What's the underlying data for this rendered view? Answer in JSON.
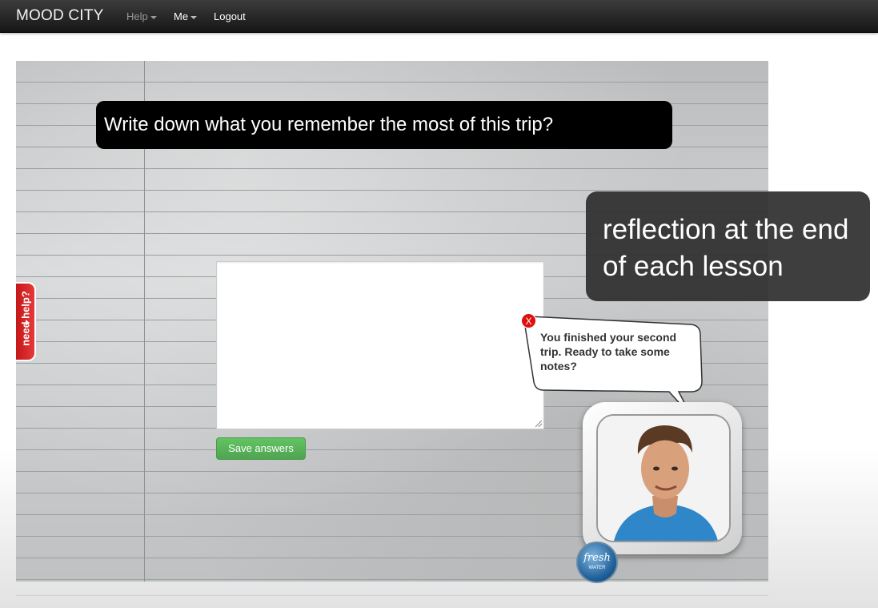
{
  "navbar": {
    "brand": "MOOD CITY",
    "items": [
      {
        "label": "Help"
      },
      {
        "label": "Me"
      },
      {
        "label": "Logout"
      }
    ]
  },
  "question": {
    "text": "Write down what you remember the most of this trip?"
  },
  "answer": {
    "value": ""
  },
  "save_button": {
    "label": "Save answers"
  },
  "help_tab": {
    "label": "need help?"
  },
  "annotation": {
    "text": "reflection at the end of each lesson"
  },
  "speech_bubble": {
    "text": "You finished your second trip. Ready to take some notes?",
    "close_label": "X"
  },
  "badge": {
    "main": "fresh",
    "sub": "WATER"
  },
  "colors": {
    "navbar": "#1b1b1b",
    "question_bg": "#000000",
    "save_button": "#5bb75b",
    "help_tab": "#d42020",
    "close_button": "#dd1010"
  }
}
